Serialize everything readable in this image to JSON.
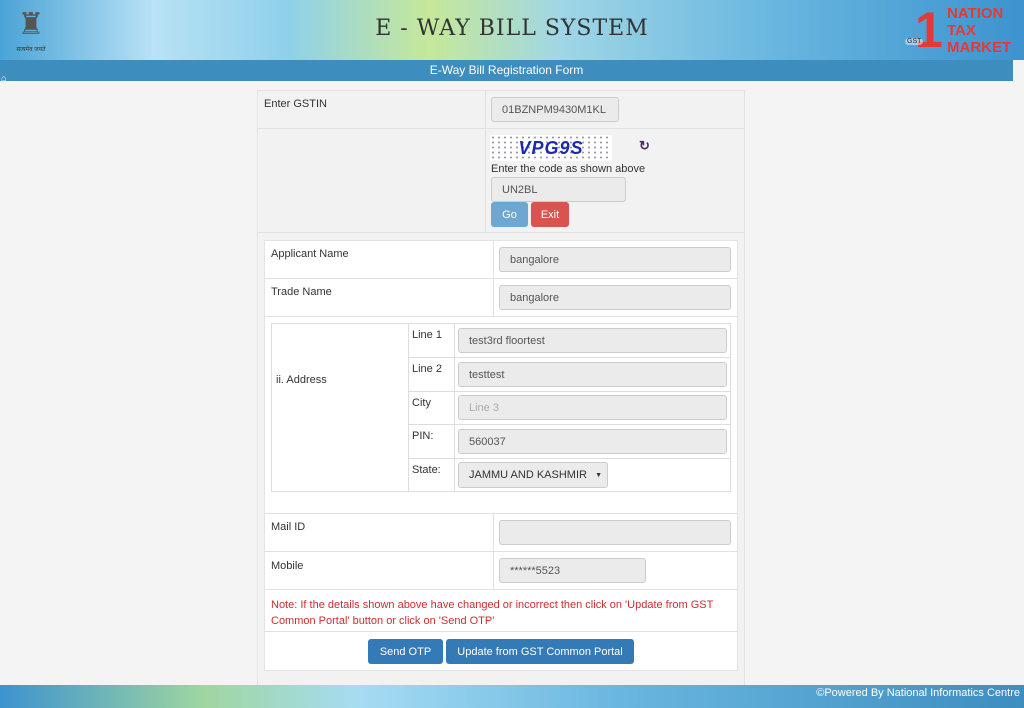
{
  "header": {
    "title": "E - WAY BILL SYSTEM",
    "emblem_motto": "सत्यमेव जयते",
    "logo_lines": [
      "NATION",
      "TAX",
      "MARKET"
    ],
    "logo_badge": "GST"
  },
  "bar": {
    "title": "E-Way Bill Registration Form"
  },
  "gstin": {
    "label": "Enter GSTIN",
    "value": "01BZNPM9430M1KL"
  },
  "captcha": {
    "image_text": "VPG9S",
    "hint": "Enter the code as shown above",
    "value": "UN2BL",
    "go": "Go",
    "exit": "Exit"
  },
  "applicant": {
    "label": "Applicant Name",
    "value": "bangalore"
  },
  "trade": {
    "label": "Trade Name",
    "value": "bangalore"
  },
  "address": {
    "label": "ii. Address",
    "line1_label": "Line 1",
    "line1": "test3rd floortest",
    "line2_label": "Line 2",
    "line2": "testtest",
    "city_label": "City",
    "city_placeholder": "Line 3",
    "pin_label": "PIN:",
    "pin": "560037",
    "state_label": "State:",
    "state": "JAMMU AND KASHMIR"
  },
  "mail": {
    "label": "Mail ID",
    "value": ""
  },
  "mobile": {
    "label": "Mobile",
    "value": "******5523"
  },
  "note": "Note: If the details shown above have changed or incorrect then click on 'Update from GST Common Portal' button or click on 'Send OTP'",
  "buttons": {
    "send_otp": "Send OTP",
    "update": "Update from GST Common Portal"
  },
  "footer": {
    "text": "Powered By National Informatics Centre"
  },
  "colors": {
    "bar": "#3d8dbf",
    "primary": "#337ab7",
    "go": "#6fa7d3",
    "danger": "#d9534f",
    "note": "#c9302c"
  }
}
